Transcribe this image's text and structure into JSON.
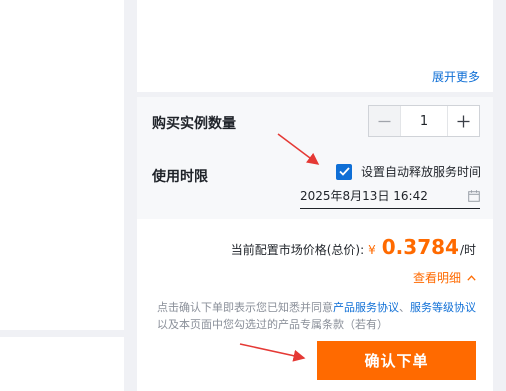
{
  "top_card": {
    "expand_link": "展开更多"
  },
  "config": {
    "quantity_label": "购买实例数量",
    "quantity_value": "1",
    "duration_label": "使用时限",
    "auto_release_label": "设置自动释放服务时间",
    "auto_release_checked": true,
    "release_datetime": "2025年8月13日 16:42"
  },
  "pricing": {
    "label": "当前配置市场价格(总价):",
    "currency": "¥",
    "amount": "0.3784",
    "unit": "/时",
    "detail_link": "查看明细"
  },
  "agreement": {
    "prefix": "点击确认下单即表示您已知悉并同意",
    "link1": "产品服务协议",
    "sep": "、",
    "link2": "服务等级协议",
    "suffix": "以及本页面中您勾选过的产品专属条款（若有）"
  },
  "confirm_button": "确认下单",
  "colors": {
    "accent": "#ff6a00",
    "link": "#0f6fd6",
    "annotation": "#e53935"
  },
  "icons": [
    "minus-icon",
    "plus-icon",
    "checkbox-check-icon",
    "calendar-icon",
    "chevron-up-icon"
  ]
}
